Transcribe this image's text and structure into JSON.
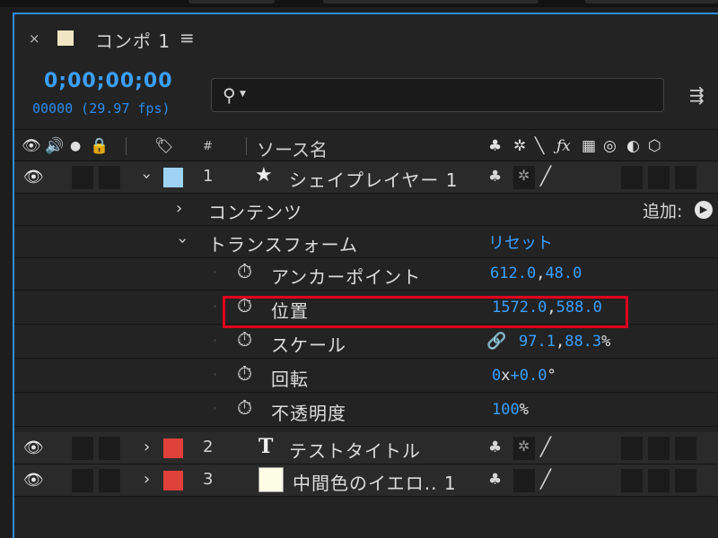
{
  "panel": {
    "close_label": "×",
    "comp_name": "コンポ 1",
    "menu_label": "≡",
    "timecode": "0;00;00;00",
    "frame_readout": "00000 (29.97 fps)",
    "search_placeholder": ""
  },
  "header": {
    "source_name_label": "ソース名",
    "hash_label": "#"
  },
  "layers": [
    {
      "num": "1",
      "name": "シェイプレイヤー 1",
      "color": "#9ed3f5"
    },
    {
      "num": "2",
      "name": "テストタイトル",
      "color": "#e0403a"
    },
    {
      "num": "3",
      "name": "中間色のイエロ.. 1",
      "color": "#e0403a"
    }
  ],
  "groups": {
    "contents_label": "コンテンツ",
    "add_label": "追加:",
    "transform_label": "トランスフォーム",
    "reset_label": "リセット"
  },
  "properties": {
    "anchor": {
      "label": "アンカーポイント",
      "x": "612.0",
      "y": "48.0"
    },
    "position": {
      "label": "位置",
      "x": "1572.0",
      "y": "588.0"
    },
    "scale": {
      "label": "スケール",
      "x": "97.1",
      "y": "88.3",
      "unit": "%"
    },
    "rotation": {
      "label": "回転",
      "turns": "0",
      "x_sep": "x",
      "deg": "+0.0",
      "unit": "°"
    },
    "opacity": {
      "label": "不透明度",
      "value": "100",
      "unit": "%"
    }
  },
  "separator": ",",
  "colors": {
    "accent": "#3aa0ff",
    "highlight_box": "#e0001b",
    "shape_label": "#9ed3f5",
    "red_label": "#e0403a"
  }
}
